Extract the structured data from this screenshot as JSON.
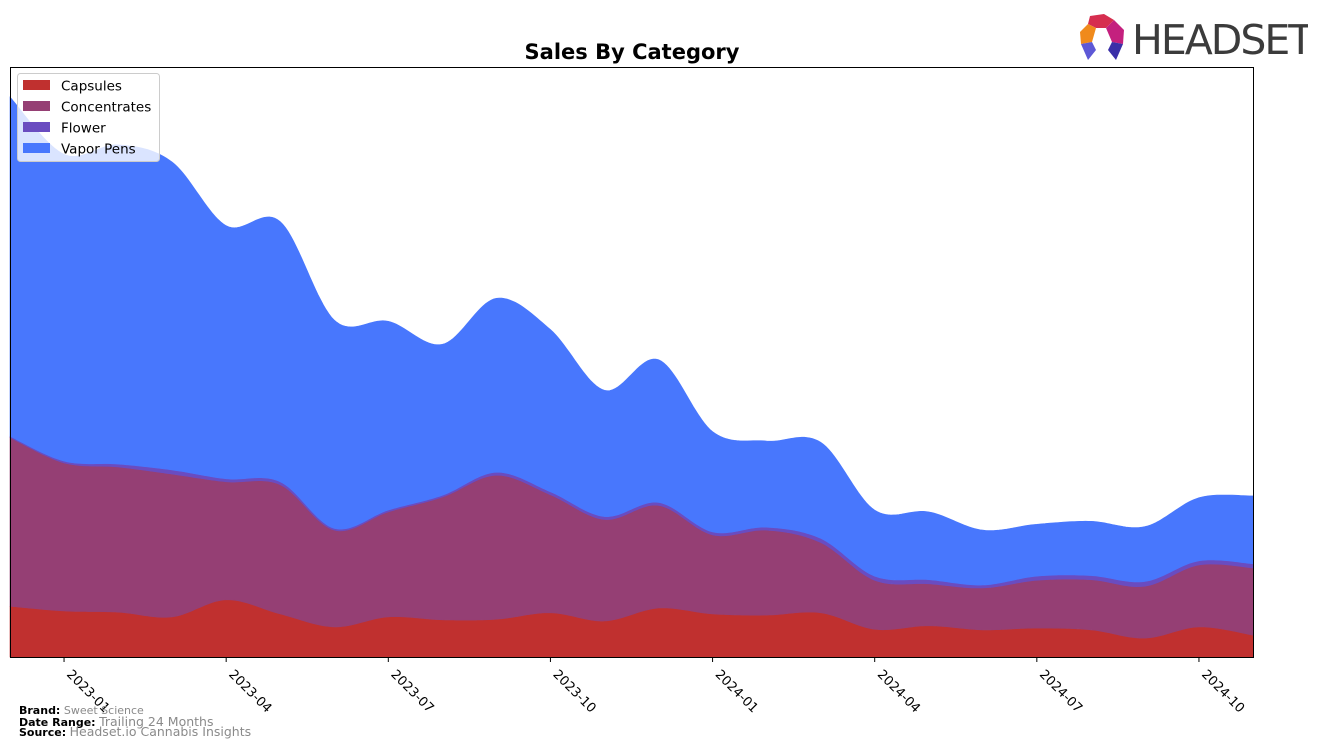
{
  "brand_logo": {
    "text": "HEADSET"
  },
  "footer": {
    "brand_label": "Brand:",
    "brand_value": "Sweet Science",
    "date_range_label": "Date Range:",
    "date_range_value": "Trailing 24 Months",
    "source_label": "Source:",
    "source_value": "Headset.io Cannabis Insights"
  },
  "chart_data": {
    "type": "area",
    "stacked": true,
    "smoothed": true,
    "title": "Sales By Category",
    "xlabel": "",
    "ylabel": "",
    "y_axis_visible": false,
    "y_units": "relative (no axis shown)",
    "ylim": [
      0,
      100
    ],
    "grid": false,
    "legend_position": "top-left",
    "x": [
      "2022-12",
      "2023-01",
      "2023-02",
      "2023-03",
      "2023-04",
      "2023-05",
      "2023-06",
      "2023-07",
      "2023-08",
      "2023-09",
      "2023-10",
      "2023-11",
      "2023-12",
      "2024-01",
      "2024-02",
      "2024-03",
      "2024-04",
      "2024-05",
      "2024-06",
      "2024-07",
      "2024-08",
      "2024-09",
      "2024-10",
      "2024-11"
    ],
    "x_ticks": [
      "2023-01",
      "2023-04",
      "2023-07",
      "2023-10",
      "2024-01",
      "2024-04",
      "2024-07",
      "2024-10"
    ],
    "series": [
      {
        "name": "Capsules",
        "color": "#c0302f",
        "values": [
          8.6,
          7.8,
          7.6,
          6.8,
          9.7,
          7.3,
          5.1,
          6.8,
          6.3,
          6.4,
          7.5,
          6.1,
          8.3,
          7.3,
          7.1,
          7.5,
          4.7,
          5.3,
          4.6,
          4.9,
          4.6,
          3.2,
          5.1,
          3.7
        ]
      },
      {
        "name": "Concentrates",
        "color": "#953f74",
        "values": [
          28.6,
          25.1,
          24.6,
          24.2,
          20.0,
          21.9,
          16.4,
          17.8,
          20.8,
          24.4,
          20.0,
          17.2,
          17.4,
          13.4,
          14.4,
          11.9,
          8.3,
          7.1,
          7.1,
          8.1,
          8.5,
          8.8,
          10.5,
          11.4
        ]
      },
      {
        "name": "Flower",
        "color": "#6a4cc0",
        "values": [
          0.2,
          0.3,
          0.5,
          0.7,
          0.5,
          0.5,
          0.3,
          0.3,
          0.3,
          0.5,
          0.5,
          0.5,
          0.5,
          0.5,
          0.5,
          0.7,
          0.7,
          0.7,
          0.5,
          0.7,
          0.7,
          0.8,
          0.7,
          0.7
        ]
      },
      {
        "name": "Vapor Pens",
        "color": "#4877fd",
        "values": [
          57.5,
          52.0,
          54.1,
          52.2,
          42.9,
          44.1,
          35.3,
          32.0,
          25.6,
          29.5,
          27.5,
          21.4,
          24.2,
          17.0,
          14.6,
          16.3,
          11.2,
          11.5,
          9.3,
          8.8,
          9.2,
          9.3,
          10.7,
          11.5
        ]
      }
    ]
  }
}
